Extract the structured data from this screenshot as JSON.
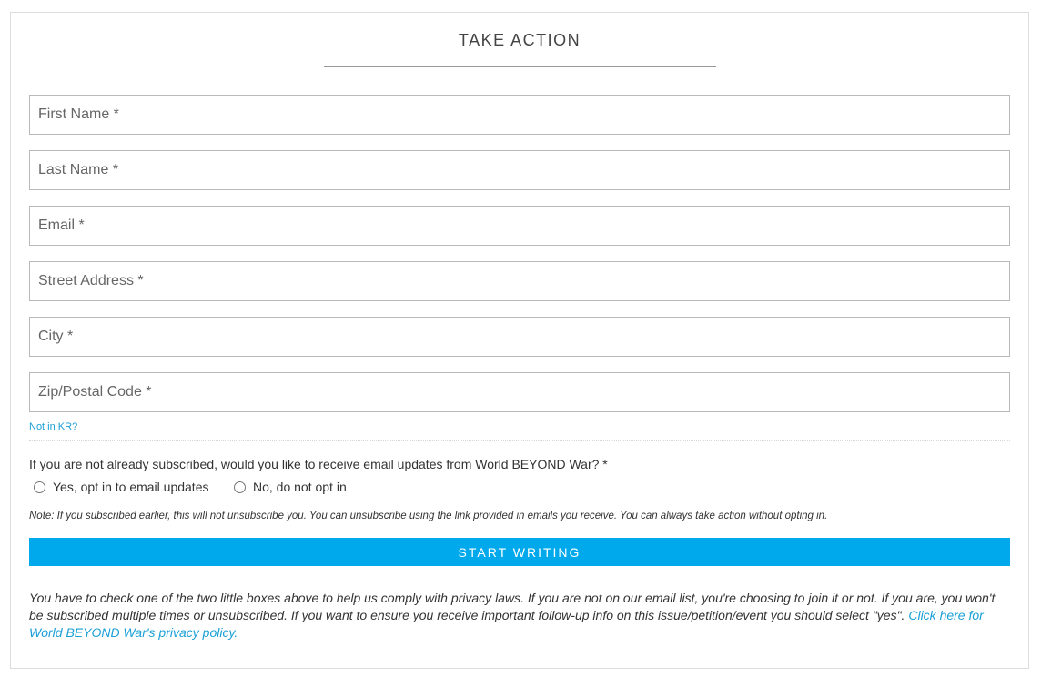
{
  "form": {
    "title": "TAKE ACTION",
    "fields": {
      "first_name": {
        "placeholder": "First Name *",
        "value": ""
      },
      "last_name": {
        "placeholder": "Last Name *",
        "value": ""
      },
      "email": {
        "placeholder": "Email *",
        "value": ""
      },
      "street": {
        "placeholder": "Street Address *",
        "value": ""
      },
      "city": {
        "placeholder": "City *",
        "value": ""
      },
      "zip": {
        "placeholder": "Zip/Postal Code *",
        "value": ""
      }
    },
    "not_in_region_link": "Not in KR?",
    "optin": {
      "question": "If you are not already subscribed, would you like to receive email updates from World BEYOND War? *",
      "yes_label": "Yes, opt in to email updates",
      "no_label": "No, do not opt in",
      "selected": ""
    },
    "note": "Note: If you subscribed earlier, this will not unsubscribe you. You can unsubscribe using the link provided in emails you receive. You can always take action without opting in.",
    "submit_label": "START WRITING",
    "privacy_text": "You have to check one of the two little boxes above to help us comply with privacy laws. If you are not on our email list, you're choosing to join it or not. If you are, you won't be subscribed multiple times or unsubscribed. If you want to ensure you receive important follow-up info on this issue/petition/event you should select \"yes\". ",
    "privacy_link": "Click here for World BEYOND War's privacy policy."
  },
  "colors": {
    "accent": "#00a8ec",
    "link": "#1a9fd6",
    "border": "#b9b9b9"
  }
}
